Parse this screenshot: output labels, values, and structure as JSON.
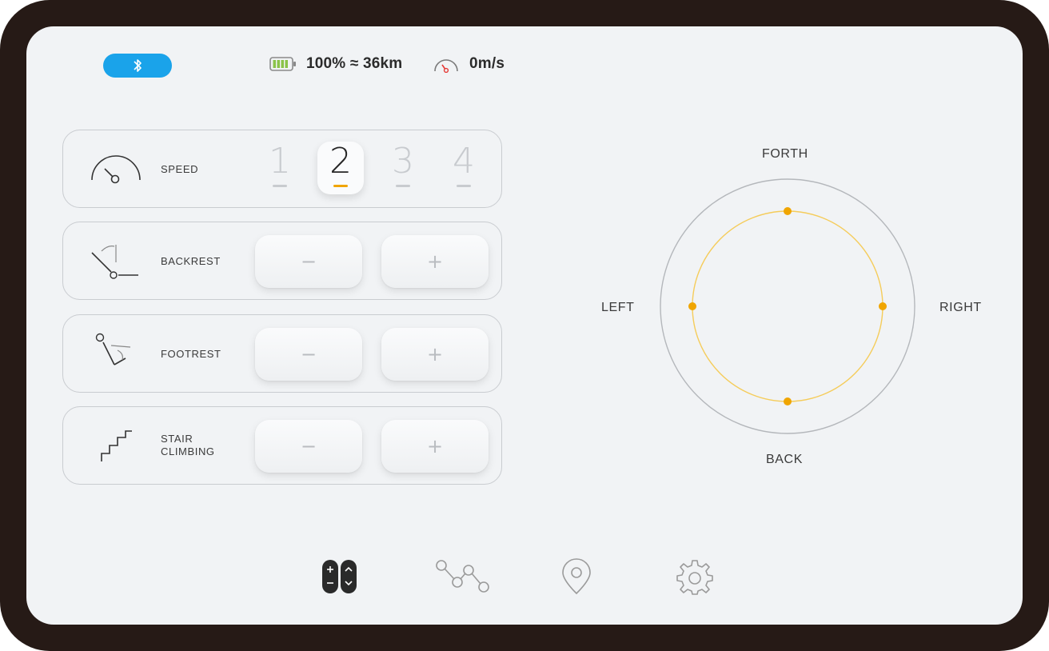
{
  "status": {
    "bluetooth": "bluetooth-icon",
    "battery_text": "100% ≈ 36km",
    "speed_text": "0m/s"
  },
  "controls": {
    "speed": {
      "label": "SPEED",
      "levels": [
        "1",
        "2",
        "3",
        "4"
      ],
      "selected_level": "2"
    },
    "backrest": {
      "label": "BACKREST",
      "minus": "−",
      "plus": "+"
    },
    "footrest": {
      "label": "FOOTREST",
      "minus": "−",
      "plus": "+"
    },
    "stair": {
      "label_line1": "STAIR",
      "label_line2": "CLIMBING",
      "minus": "−",
      "plus": "+"
    }
  },
  "joystick": {
    "forth": "FORTH",
    "back": "BACK",
    "left": "LEFT",
    "right": "RIGHT"
  },
  "nav": {
    "items": [
      "remote-control-icon",
      "route-icon",
      "location-pin-icon",
      "settings-gear-icon"
    ],
    "active": "remote-control-icon"
  },
  "colors": {
    "accent": "#F0A500",
    "bluetooth": "#1AA3EA",
    "battery": "#8BC34A",
    "gauge_needle": "#E53935",
    "frame": "#261A16",
    "screen": "#F1F3F5"
  }
}
